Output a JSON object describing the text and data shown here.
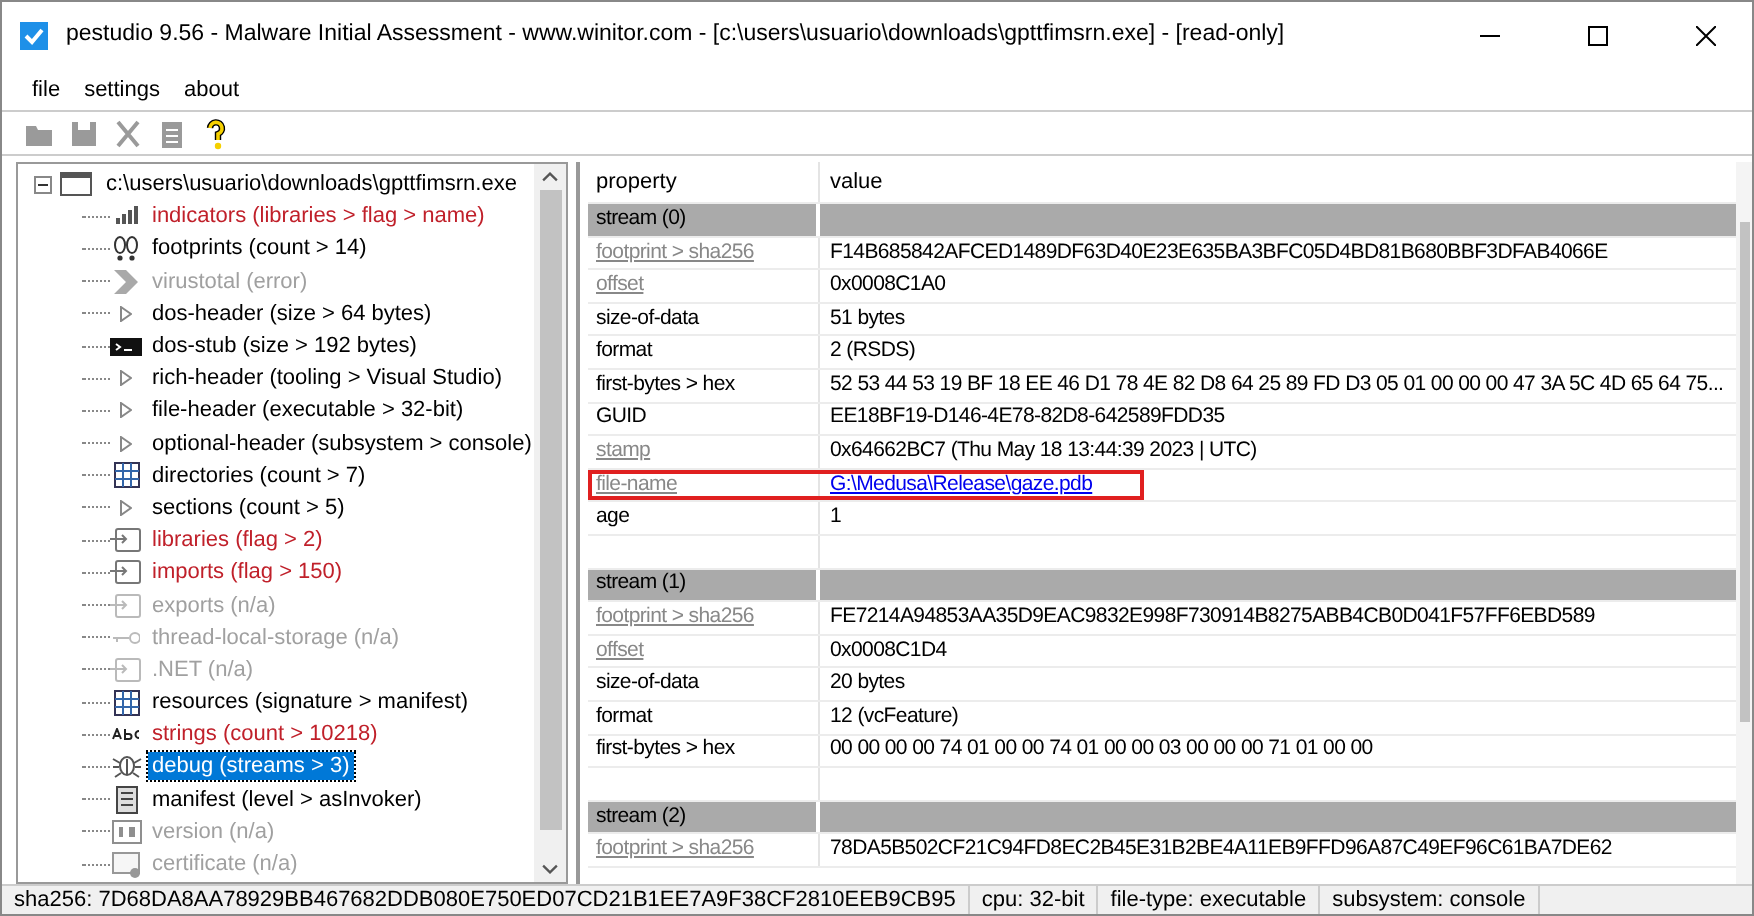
{
  "window": {
    "title": "pestudio 9.56 - Malware Initial Assessment - www.winitor.com - [c:\\users\\usuario\\downloads\\gpttfimsrn.exe] - [read-only]"
  },
  "menu": [
    "file",
    "settings",
    "about"
  ],
  "toolbar": [
    {
      "kind": "open",
      "disabled": true
    },
    {
      "kind": "save",
      "disabled": true
    },
    {
      "kind": "cut",
      "disabled": true
    },
    {
      "kind": "clipboard",
      "disabled": true
    },
    {
      "kind": "help",
      "disabled": false
    }
  ],
  "tree": {
    "label": "c:\\users\\usuario\\downloads\\gpttfimsrn.exe",
    "expanded": true,
    "children": [
      {
        "label": "indicators (libraries > flag > name)",
        "kind": "bars",
        "alert": true,
        "disabled": false,
        "selected": false
      },
      {
        "label": "footprints (count > 14)",
        "kind": "footprint",
        "alert": false,
        "disabled": false,
        "selected": false
      },
      {
        "label": "virustotal (error)",
        "kind": "arrow",
        "alert": false,
        "disabled": true,
        "selected": false
      },
      {
        "label": "dos-header (size > 64 bytes)",
        "kind": "triangle",
        "alert": false,
        "disabled": false,
        "selected": false
      },
      {
        "label": "dos-stub (size > 192 bytes)",
        "kind": "console",
        "alert": false,
        "disabled": false,
        "selected": false
      },
      {
        "label": "rich-header (tooling > Visual Studio)",
        "kind": "triangle",
        "alert": false,
        "disabled": false,
        "selected": false
      },
      {
        "label": "file-header (executable > 32-bit)",
        "kind": "triangle",
        "alert": false,
        "disabled": false,
        "selected": false
      },
      {
        "label": "optional-header (subsystem > console)",
        "kind": "triangle",
        "alert": false,
        "disabled": false,
        "selected": false
      },
      {
        "label": "directories (count > 7)",
        "kind": "grid",
        "alert": false,
        "disabled": false,
        "selected": false
      },
      {
        "label": "sections (count > 5)",
        "kind": "triangle",
        "alert": false,
        "disabled": false,
        "selected": false
      },
      {
        "label": "libraries (flag > 2)",
        "kind": "module",
        "alert": true,
        "disabled": false,
        "selected": false
      },
      {
        "label": "imports (flag > 150)",
        "kind": "module",
        "alert": true,
        "disabled": false,
        "selected": false
      },
      {
        "label": "exports (n/a)",
        "kind": "module",
        "alert": false,
        "disabled": true,
        "selected": false
      },
      {
        "label": "thread-local-storage (n/a)",
        "kind": "key",
        "alert": false,
        "disabled": true,
        "selected": false
      },
      {
        "label": ".NET (n/a)",
        "kind": "module",
        "alert": false,
        "disabled": true,
        "selected": false
      },
      {
        "label": "resources (signature > manifest)",
        "kind": "grid",
        "alert": false,
        "disabled": false,
        "selected": false
      },
      {
        "label": "strings (count > 10218)",
        "kind": "abc",
        "alert": true,
        "disabled": false,
        "selected": false
      },
      {
        "label": "debug (streams > 3)",
        "kind": "bug",
        "alert": false,
        "disabled": false,
        "selected": true
      },
      {
        "label": "manifest (level > asInvoker)",
        "kind": "document",
        "alert": false,
        "disabled": false,
        "selected": false
      },
      {
        "label": "version (n/a)",
        "kind": "version",
        "alert": false,
        "disabled": true,
        "selected": false
      },
      {
        "label": "certificate (n/a)",
        "kind": "certificate",
        "alert": false,
        "disabled": true,
        "selected": false
      }
    ]
  },
  "table": {
    "columns": [
      "property",
      "value"
    ],
    "rows": [
      {
        "kind": "section",
        "property": "stream (0)"
      },
      {
        "kind": "row",
        "property": "footprint > sha256",
        "value": "F14B685842AFCED1489DF63D40E23E635BA3BFC05D4BD81B680BBF3DFAB4066E",
        "link": true,
        "value_link": false,
        "highlighted": false
      },
      {
        "kind": "row",
        "property": "offset",
        "value": "0x0008C1A0",
        "link": true,
        "value_link": false,
        "highlighted": false
      },
      {
        "kind": "row",
        "property": "size-of-data",
        "value": "51 bytes",
        "link": false,
        "value_link": false,
        "highlighted": false
      },
      {
        "kind": "row",
        "property": "format",
        "value": "2 (RSDS)",
        "link": false,
        "value_link": false,
        "highlighted": false
      },
      {
        "kind": "row",
        "property": "first-bytes > hex",
        "value": "52 53 44 53 19 BF 18 EE 46 D1 78 4E 82 D8 64 25 89 FD D3 05 01 00 00 00 47 3A 5C 4D 65 64 75...",
        "link": false,
        "value_link": false,
        "highlighted": false
      },
      {
        "kind": "row",
        "property": "GUID",
        "value": "EE18BF19-D146-4E78-82D8-642589FDD35",
        "link": false,
        "value_link": false,
        "highlighted": false
      },
      {
        "kind": "row",
        "property": "stamp",
        "value": "0x64662BC7 (Thu May 18 13:44:39 2023 | UTC)",
        "link": true,
        "value_link": false,
        "highlighted": false
      },
      {
        "kind": "row",
        "property": "file-name",
        "value": "G:\\Medusa\\Release\\gaze.pdb",
        "link": true,
        "value_link": true,
        "highlighted": true
      },
      {
        "kind": "row",
        "property": "age",
        "value": "1",
        "link": false,
        "value_link": false,
        "highlighted": false
      },
      {
        "kind": "blank"
      },
      {
        "kind": "section",
        "property": "stream (1)"
      },
      {
        "kind": "row",
        "property": "footprint > sha256",
        "value": "FE7214A94853AA35D9EAC9832E998F730914B8275ABB4CB0D041F57FF6EBD589",
        "link": true,
        "value_link": false,
        "highlighted": false
      },
      {
        "kind": "row",
        "property": "offset",
        "value": "0x0008C1D4",
        "link": true,
        "value_link": false,
        "highlighted": false
      },
      {
        "kind": "row",
        "property": "size-of-data",
        "value": "20 bytes",
        "link": false,
        "value_link": false,
        "highlighted": false
      },
      {
        "kind": "row",
        "property": "format",
        "value": "12 (vcFeature)",
        "link": false,
        "value_link": false,
        "highlighted": false
      },
      {
        "kind": "row",
        "property": "first-bytes > hex",
        "value": "00 00 00 00 74 01 00 00 74 01 00 00 03 00 00 00 71 01 00 00",
        "link": false,
        "value_link": false,
        "highlighted": false
      },
      {
        "kind": "blank"
      },
      {
        "kind": "section",
        "property": "stream (2)"
      },
      {
        "kind": "row",
        "property": "footprint > sha256",
        "value": "78DA5B502CF21C94FD8EC2B45E31B2BE4A11EB9FFD96A87C49EF96C61BA7DE62",
        "link": true,
        "value_link": false,
        "highlighted": false
      }
    ]
  },
  "status_bar": [
    "sha256: 7D68DA8AA78929BB467682DDB080E750ED07CD21B1EE7A9F38CF2810EEB9CB95",
    "cpu: 32-bit",
    "file-type: executable",
    "subsystem: console"
  ]
}
